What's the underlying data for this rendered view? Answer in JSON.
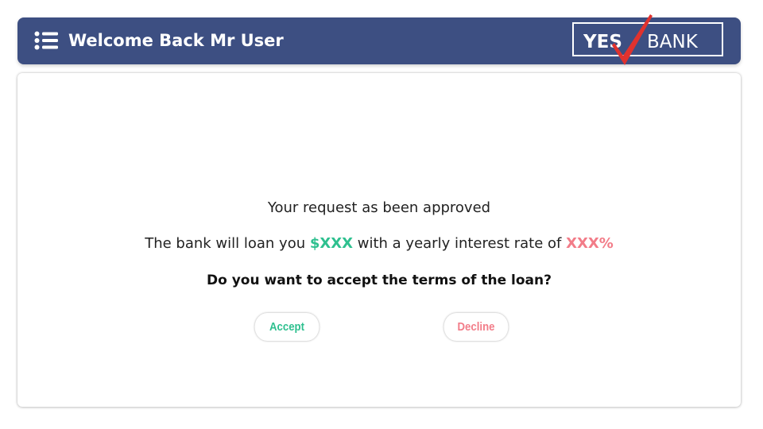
{
  "header": {
    "title": "Welcome Back Mr User",
    "logo_text_left": "YES",
    "logo_text_right": "BANK"
  },
  "message": {
    "approved": "Your request as been approved",
    "loan_prefix": "The bank will loan you",
    "loan_amount": "$XXX",
    "loan_middle": "with a yearly interest rate of",
    "interest_rate": "XXX%",
    "question": "Do you want to accept the terms of the loan?"
  },
  "actions": {
    "accept_label": "Accept",
    "decline_label": "Decline"
  },
  "colors": {
    "header_bg": "#3d4f82",
    "accept": "#2ec08f",
    "decline": "#f27c88",
    "logo_check": "#e0322e"
  }
}
